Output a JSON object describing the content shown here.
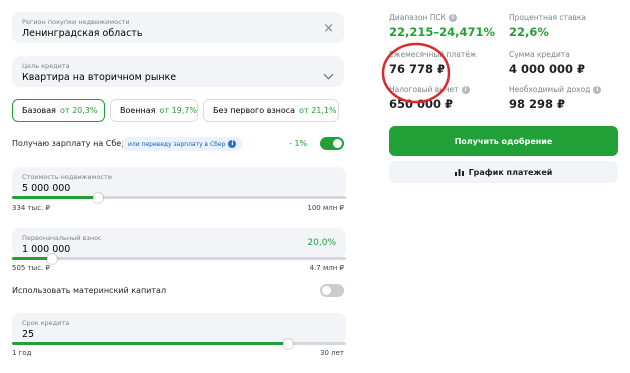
{
  "region": {
    "label": "Регион покупки недвижимости",
    "value": "Ленинградская область"
  },
  "purpose": {
    "label": "Цель кредита",
    "value": "Квартира на вторичном рынке"
  },
  "programs": [
    {
      "name": "Базовая",
      "rate": "от 20,3%"
    },
    {
      "name": "Военная",
      "rate": "от 19,7%"
    },
    {
      "name": "Без первого взноса",
      "rate": "от 21,1%"
    }
  ],
  "salary": {
    "label": "Получаю зарплату на Сбер",
    "chip": "или переведу зарплату в Сбер",
    "discount": "- 1%"
  },
  "property_cost": {
    "label": "Стоимость недвижимости",
    "value": "5 000 000",
    "min": "334 тыс. ₽",
    "max": "100 млн ₽",
    "level": 0.25
  },
  "down_payment": {
    "label": "Первоначальный взнос",
    "value": "1 000 000",
    "percent": "20,0%",
    "min": "505 тыс. ₽",
    "max": "4.7 млн ₽",
    "level": 0.12
  },
  "maternity": {
    "label": "Использовать материнский капитал"
  },
  "term": {
    "label": "Срок кредита",
    "value": "25",
    "min": "1 год",
    "max": "30 лет",
    "level": 0.83
  },
  "summary": {
    "psk_label": "Диапазон ПСК",
    "psk_value": "22,215–24,471%",
    "rate_label": "Процентная ставка",
    "rate_value": "22,6%",
    "monthly_label": "Ежемесячный платёж",
    "monthly_value": "76 778 ₽",
    "loan_label": "Сумма кредита",
    "loan_value": "4 000 000 ₽",
    "tax_label": "Налоговый вычет",
    "tax_value": "650 000 ₽",
    "income_label": "Необходимый доход",
    "income_value": "98 298 ₽"
  },
  "buttons": {
    "approve": "Получить одобрение",
    "schedule": "График платежей"
  },
  "colors": {
    "accent": "#21a038",
    "annotation": "#d92b2b"
  }
}
